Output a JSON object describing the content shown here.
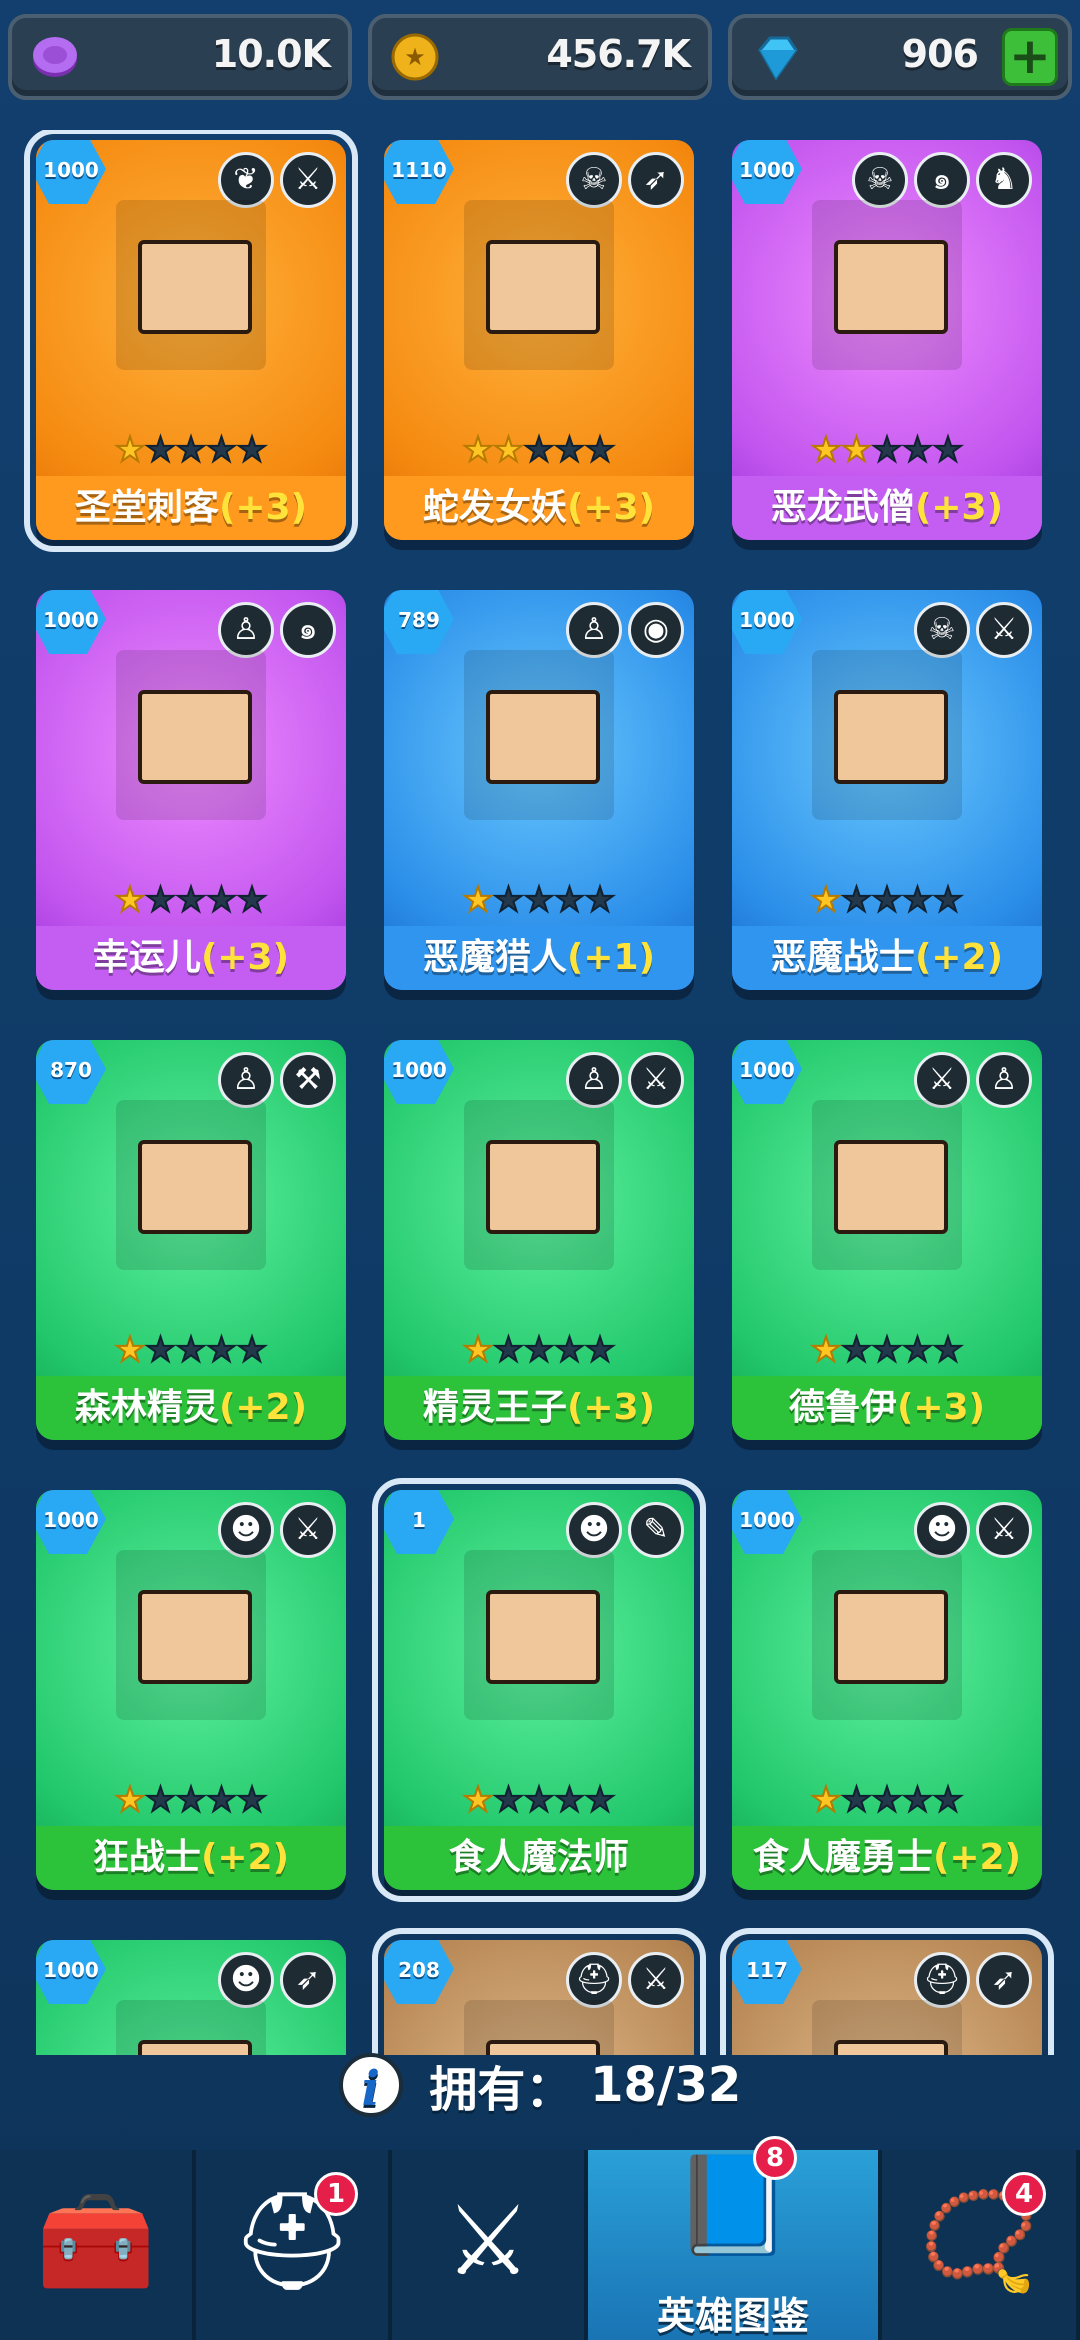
{
  "currencies": [
    {
      "icon": "purple-token-icon",
      "value": "10.0K",
      "color": "#a45be0"
    },
    {
      "icon": "gold-coin-icon",
      "value": "456.7K",
      "color": "#f3b820"
    },
    {
      "icon": "blue-gem-icon",
      "value": "906",
      "color": "#37b6f0"
    }
  ],
  "add_label": "+",
  "heroes": [
    {
      "level": "1000",
      "name": "圣堂刺客",
      "bonus": "(+3)",
      "stars": 1,
      "rarity": "orange",
      "selected": true,
      "badges": [
        "wing-icon",
        "dagger-icon"
      ]
    },
    {
      "level": "1110",
      "name": "蛇发女妖",
      "bonus": "(+3)",
      "stars": 2,
      "rarity": "orange",
      "badges": [
        "skull-icon",
        "bow-icon"
      ]
    },
    {
      "level": "1000",
      "name": "恶龙武僧",
      "bonus": "(+3)",
      "stars": 2,
      "rarity": "purple",
      "badges": [
        "skull-icon",
        "swirl-icon",
        "dragon-icon"
      ]
    },
    {
      "level": "1000",
      "name": "幸运儿",
      "bonus": "(+3)",
      "stars": 1,
      "rarity": "purple",
      "badges": [
        "elf-icon",
        "swirl-icon"
      ]
    },
    {
      "level": "789",
      "name": "恶魔猎人",
      "bonus": "(+1)",
      "stars": 1,
      "rarity": "blue",
      "badges": [
        "elf-icon",
        "eye-icon"
      ]
    },
    {
      "level": "1000",
      "name": "恶魔战士",
      "bonus": "(+2)",
      "stars": 1,
      "rarity": "blue",
      "badges": [
        "skull-icon",
        "sword-icon"
      ]
    },
    {
      "level": "870",
      "name": "森林精灵",
      "bonus": "(+2)",
      "stars": 1,
      "rarity": "green",
      "badges": [
        "elf-icon",
        "hammer-icon"
      ]
    },
    {
      "level": "1000",
      "name": "精灵王子",
      "bonus": "(+3)",
      "stars": 1,
      "rarity": "green",
      "badges": [
        "elf-icon",
        "dagger-icon"
      ]
    },
    {
      "level": "1000",
      "name": "德鲁伊",
      "bonus": "(+3)",
      "stars": 1,
      "rarity": "green",
      "badges": [
        "sword-icon",
        "elf-icon"
      ]
    },
    {
      "level": "1000",
      "name": "狂战士",
      "bonus": "(+2)",
      "stars": 1,
      "rarity": "green",
      "badges": [
        "orc-icon",
        "sword-icon"
      ]
    },
    {
      "level": "1",
      "name": "食人魔法师",
      "bonus": "",
      "stars": 1,
      "rarity": "green",
      "selected": true,
      "badges": [
        "orc-icon",
        "wand-icon"
      ]
    },
    {
      "level": "1000",
      "name": "食人魔勇士",
      "bonus": "(+2)",
      "stars": 1,
      "rarity": "green",
      "badges": [
        "orc-icon",
        "sword-icon"
      ]
    },
    {
      "level": "1000",
      "name": "",
      "bonus": "",
      "stars": 0,
      "rarity": "green",
      "badges": [
        "orc-icon",
        "bow-icon"
      ]
    },
    {
      "level": "208",
      "name": "",
      "bonus": "",
      "stars": 0,
      "rarity": "brown",
      "selected": true,
      "badges": [
        "helmet-icon",
        "sword-icon"
      ]
    },
    {
      "level": "117",
      "name": "",
      "bonus": "",
      "stars": 0,
      "rarity": "brown",
      "selected": true,
      "badges": [
        "helmet-icon",
        "bow-icon"
      ]
    }
  ],
  "owned": {
    "label": "拥有：",
    "count": "18/32"
  },
  "nav": [
    {
      "icon": "treasure-chest-icon",
      "label": "",
      "badge": ""
    },
    {
      "icon": "viking-helmet-icon",
      "label": "",
      "badge": "1"
    },
    {
      "icon": "crossed-swords-icon",
      "label": "",
      "badge": ""
    },
    {
      "icon": "hero-book-icon",
      "label": "英雄图鉴",
      "badge": "8",
      "active": true
    },
    {
      "icon": "amulet-icon",
      "label": "",
      "badge": "4"
    }
  ]
}
